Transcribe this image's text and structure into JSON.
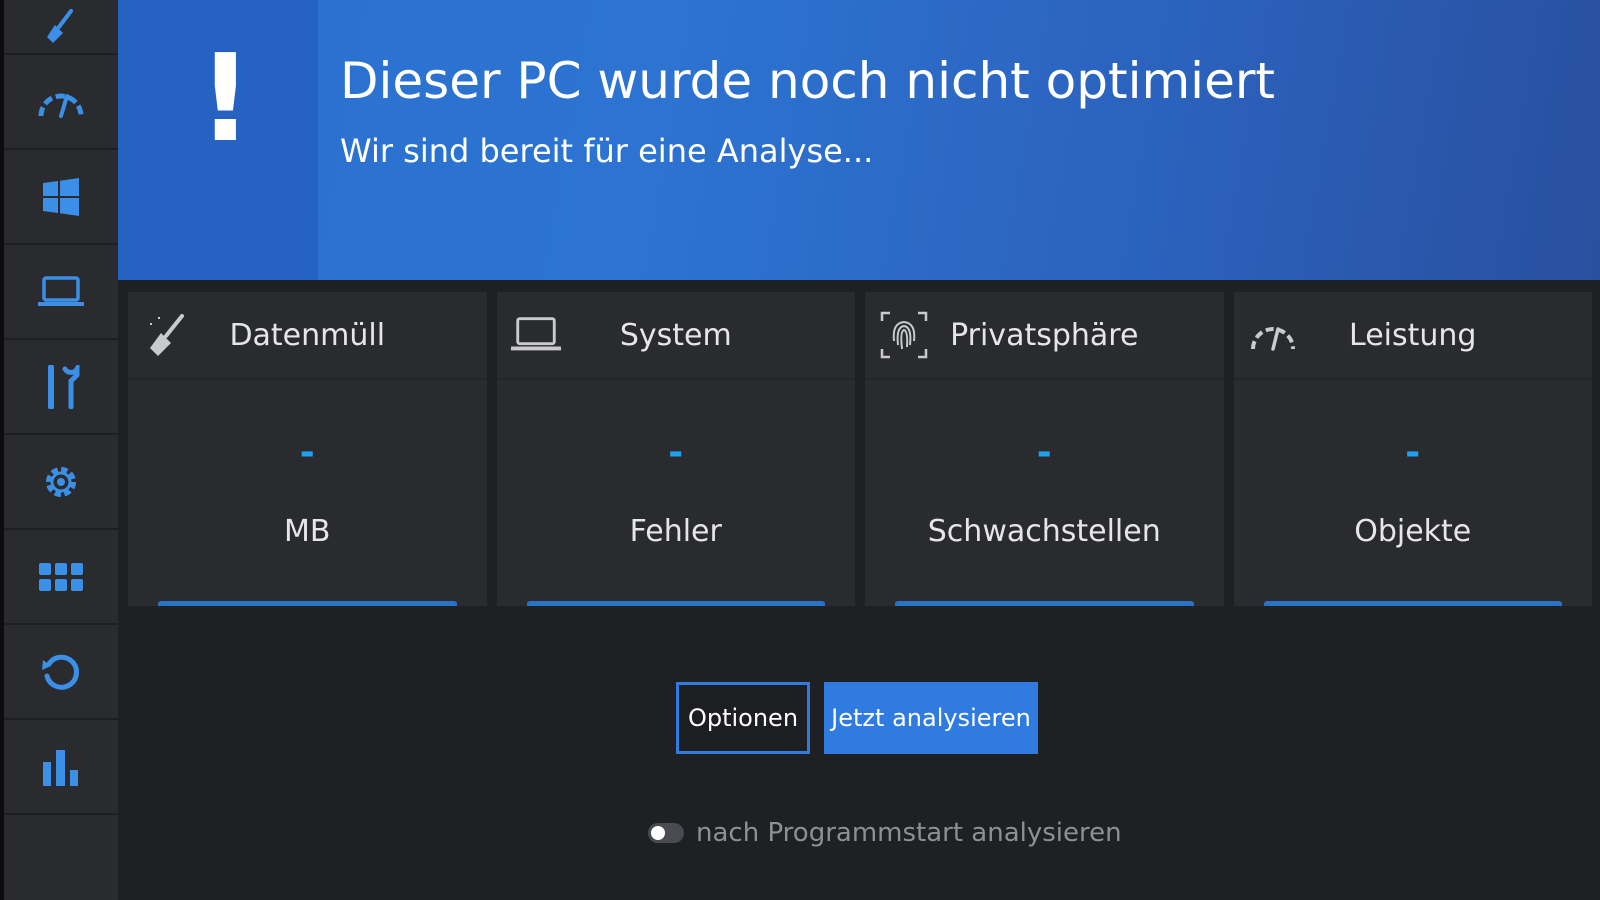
{
  "sidebar": {
    "items": [
      {
        "icon": "broom-icon"
      },
      {
        "icon": "speedometer-icon"
      },
      {
        "icon": "windows-icon"
      },
      {
        "icon": "laptop-icon"
      },
      {
        "icon": "tools-icon"
      },
      {
        "icon": "gear-icon"
      },
      {
        "icon": "grid-icon"
      },
      {
        "icon": "refresh-icon"
      },
      {
        "icon": "bar-chart-icon"
      }
    ]
  },
  "banner": {
    "symbol": "!",
    "title": "Dieser PC wurde noch nicht optimiert",
    "subtitle": "Wir sind bereit für eine Analyse..."
  },
  "cards": [
    {
      "title": "Datenmüll",
      "icon": "broom-icon",
      "value": "-",
      "unit": "MB"
    },
    {
      "title": "System",
      "icon": "laptop-icon",
      "value": "-",
      "unit": "Fehler"
    },
    {
      "title": "Privatsphäre",
      "icon": "fingerprint-icon",
      "value": "-",
      "unit": "Schwachstellen"
    },
    {
      "title": "Leistung",
      "icon": "speedometer-icon",
      "value": "-",
      "unit": "Objekte"
    }
  ],
  "actions": {
    "options_label": "Optionen",
    "analyze_label": "Jetzt analysieren"
  },
  "autostart": {
    "label": "nach Programmstart analysieren",
    "enabled": false
  },
  "colors": {
    "accent": "#2f7be0",
    "value": "#1ea0ef",
    "icon": "#3b8fe6",
    "sidebar_bg": "#2a2b2f",
    "content_bg": "#1f2023"
  }
}
